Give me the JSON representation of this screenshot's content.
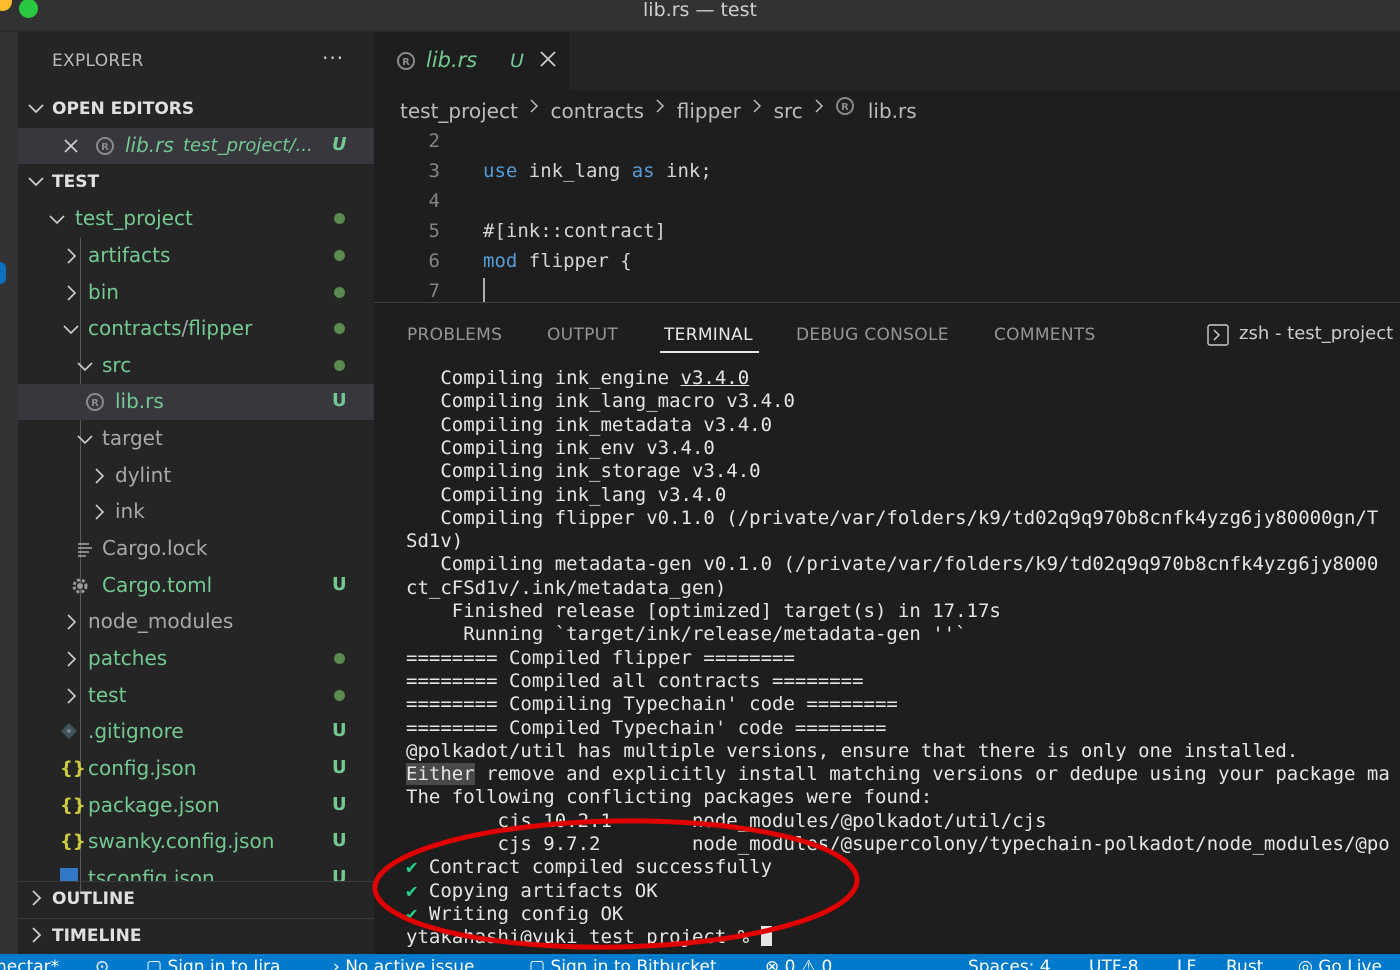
{
  "window": {
    "title": "lib.rs — test",
    "traffic_colors": {
      "yellow": "#febc2e",
      "green": "#28c840"
    }
  },
  "explorer": {
    "title": "EXPLORER",
    "more": "···",
    "open_editors": {
      "label": "OPEN EDITORS",
      "item": {
        "name": "lib.rs",
        "path": "test_project/...",
        "badge": "U"
      }
    },
    "root": {
      "label": "TEST",
      "items": [
        {
          "name": "test_project",
          "badge": ""
        },
        {
          "name": "artifacts",
          "badge": ""
        },
        {
          "name": "bin",
          "badge": ""
        },
        {
          "name": "contracts",
          "sep": "/",
          "name2": "flipper",
          "badge": ""
        },
        {
          "name": "src",
          "badge": ""
        },
        {
          "name": "lib.rs",
          "badge": "U"
        },
        {
          "name": "target",
          "badge": ""
        },
        {
          "name": "dylint",
          "badge": ""
        },
        {
          "name": "ink",
          "badge": ""
        },
        {
          "name": "Cargo.lock",
          "badge": ""
        },
        {
          "name": "Cargo.toml",
          "badge": "U"
        },
        {
          "name": "node_modules",
          "badge": ""
        },
        {
          "name": "patches",
          "badge": ""
        },
        {
          "name": "test",
          "badge": ""
        },
        {
          "name": ".gitignore",
          "badge": "U"
        },
        {
          "name": "config.json",
          "badge": "U"
        },
        {
          "name": "package.json",
          "badge": "U"
        },
        {
          "name": "swanky.config.json",
          "badge": "U"
        },
        {
          "name": "tsconfig.json",
          "badge": "U"
        }
      ]
    },
    "outline": "OUTLINE",
    "timeline": "TIMELINE"
  },
  "editor": {
    "tab": {
      "label": "lib.rs",
      "badge": "U"
    },
    "breadcrumb": [
      "test_project",
      "contracts",
      "flipper",
      "src",
      "lib.rs"
    ],
    "lines": [
      {
        "n": "2",
        "parts": []
      },
      {
        "n": "3",
        "parts": [
          {
            "t": "use",
            "kw": true
          },
          {
            "t": " ink_lang "
          },
          {
            "t": "as",
            "kw": true
          },
          {
            "t": " ink;"
          }
        ]
      },
      {
        "n": "4",
        "parts": []
      },
      {
        "n": "5",
        "parts": [
          {
            "t": "#[ink::contract]"
          }
        ]
      },
      {
        "n": "6",
        "parts": [
          {
            "t": "mod",
            "kw": true
          },
          {
            "t": " flipper {"
          }
        ]
      },
      {
        "n": "7",
        "parts": []
      }
    ]
  },
  "panel": {
    "tabs": [
      "PROBLEMS",
      "OUTPUT",
      "TERMINAL",
      "DEBUG CONSOLE",
      "COMMENTS"
    ],
    "active_tab": "TERMINAL",
    "terminal_name": "zsh - test_project",
    "terminal_lines": [
      {
        "pre": "   Compiling ink_engine ",
        "u": "v3.4.0"
      },
      {
        "pre": "   Compiling ink_lang_macro v3.4.0"
      },
      {
        "pre": "   Compiling ink_metadata v3.4.0"
      },
      {
        "pre": "   Compiling ink_env v3.4.0"
      },
      {
        "pre": "   Compiling ink_storage v3.4.0"
      },
      {
        "pre": "   Compiling ink_lang v3.4.0"
      },
      {
        "pre": "   Compiling flipper v0.1.0 (/private/var/folders/k9/td02q9q970b8cnfk4yzg6jy80000gn/T"
      },
      {
        "pre": "Sd1v)"
      },
      {
        "pre": "   Compiling metadata-gen v0.1.0 (/private/var/folders/k9/td02q9q970b8cnfk4yzg6jy8000"
      },
      {
        "pre": "ct_cFSd1v/.ink/metadata_gen)"
      },
      {
        "pre": "    Finished release [optimized] target(s) in 17.17s"
      },
      {
        "pre": "     Running `target/ink/release/metadata-gen ''`"
      },
      {
        "pre": "======== Compiled flipper ========"
      },
      {
        "pre": "======== Compiled all contracts ========"
      },
      {
        "pre": "======== Compiling Typechain' code ========"
      },
      {
        "pre": "======== Compiled Typechain' code ========"
      },
      {
        "pre": "@polkadot/util has multiple versions, ensure that there is only one installed."
      },
      {
        "hl": "Either",
        "pre": " remove and explicitly install matching versions or dedupe using your package ma"
      },
      {
        "pre": "The following conflicting packages were found:"
      },
      {
        "pre": "        cjs 10.2.1       node_modules/@polkadot/util/cjs"
      },
      {
        "pre": "        cjs 9.7.2        node_modules/@supercolony/typechain-polkadot/node_modules/@po"
      },
      {
        "check": "✔",
        "pre": " Contract compiled successfully"
      },
      {
        "check": "✔",
        "pre": " Copying artifacts OK"
      },
      {
        "check": "✔",
        "pre": " Writing config OK"
      },
      {
        "pre": "ytakahashi@yuki test_project % ",
        "cursor": true
      }
    ],
    "annotation_color": "#e00000"
  },
  "statusbar": {
    "items": [
      "nectar*",
      "⊙",
      "Sign in to Jira",
      "No active issue",
      "Sign in to Bitbucket",
      "⊗ 0 ⚠ 0",
      "Spaces: 4",
      "UTF-8",
      "LF",
      "Rust",
      "Go Live"
    ]
  },
  "colors": {
    "accent": "#007acc",
    "untracked": "#73c991",
    "keyword": "#569cd6",
    "check": "#23d18b"
  }
}
